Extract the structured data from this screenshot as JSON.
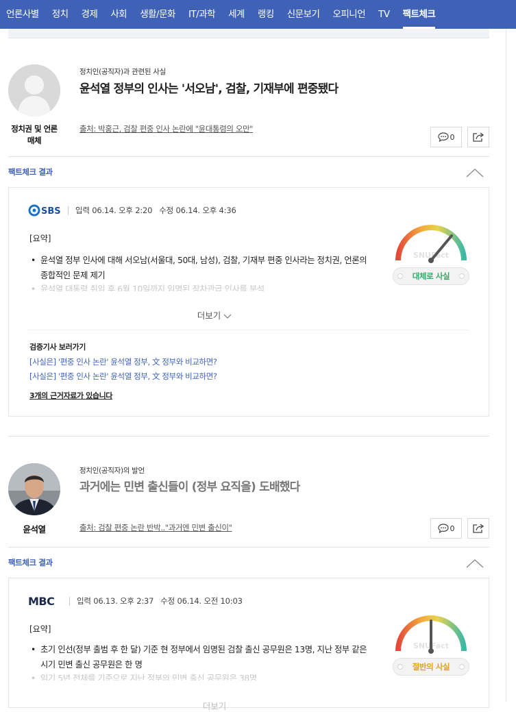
{
  "nav": {
    "items": [
      "언론사별",
      "정치",
      "경제",
      "사회",
      "생활/문화",
      "IT/과학",
      "세계",
      "랭킹",
      "신문보기",
      "오피니언",
      "TV",
      "팩트체크"
    ],
    "active": "팩트체크"
  },
  "claims": [
    {
      "speaker": "정치권 및 언론 매체",
      "category": "정치인(공직자)과 관련된 사실",
      "title": "윤석열 정부의 인사는 '서오남', 검찰, 기재부에 편중됐다",
      "source": "출처: 박홍근, 검찰 편중 인사 논란에 \"윤대통령의 오만\"",
      "comment_count": "0",
      "factcheck_label": "팩트체크 결과",
      "publisher": "SBS",
      "input_time": "입력 06.14. 오후 2:20",
      "edit_time": "수정 06.14. 오후 4:36",
      "summary_heading": "[요약]",
      "bullets": [
        "윤석열 정부 인사에 대해 서오남(서울대, 50대, 남성), 검찰, 기재부 편중 인사라는 정치권, 언론의 종합적인 문제 제기",
        "윤석열 대통령 취임 후 6월 10일까지 임명된 장차관급 인사를 분석"
      ],
      "more_label": "더보기",
      "verify_heading": "검증기사 보러가기",
      "verify_links": [
        "[사실은] '편중 인사 논란' 윤석열 정부, 文 정부와 비교하면?",
        "[사실은] '편중 인사 논란' 윤석열 정부, 文 정부와 비교하면?"
      ],
      "evidence_label": "3개의 근거자료가 있습니다",
      "gauge_watermark": "SNUFact",
      "verdict": "대체로 사실",
      "verdict_color": "#3aa868"
    },
    {
      "speaker": "윤석열",
      "category": "정치인(공직자)의 발언",
      "title": "과거에는 민변 출신들이 (정부 요직을) 도배했다",
      "source": "출처: 검찰 편중 논란 반박..\"과거엔 민변 출신이\"",
      "comment_count": "0",
      "factcheck_label": "팩트체크 결과",
      "publisher": "MBC",
      "input_time": "입력 06.13. 오후 2:37",
      "edit_time": "수정 06.14. 오전 10:03",
      "summary_heading": "[요약]",
      "bullets": [
        "초기 인선(정부 출범 후 한 달) 기준 현 정부에서 임명된 검찰 출신 공무원은 13명, 지난 정부 같은 시기 민변 출신 공무원은 한 명",
        "임기 5년 전체를 기준으로 지난 정부의 민변 출신 공무원은 38명"
      ],
      "more_label": "더보기",
      "gauge_watermark": "SNUFact",
      "verdict": "절반의 사실",
      "verdict_color": "#e0a21a"
    }
  ]
}
